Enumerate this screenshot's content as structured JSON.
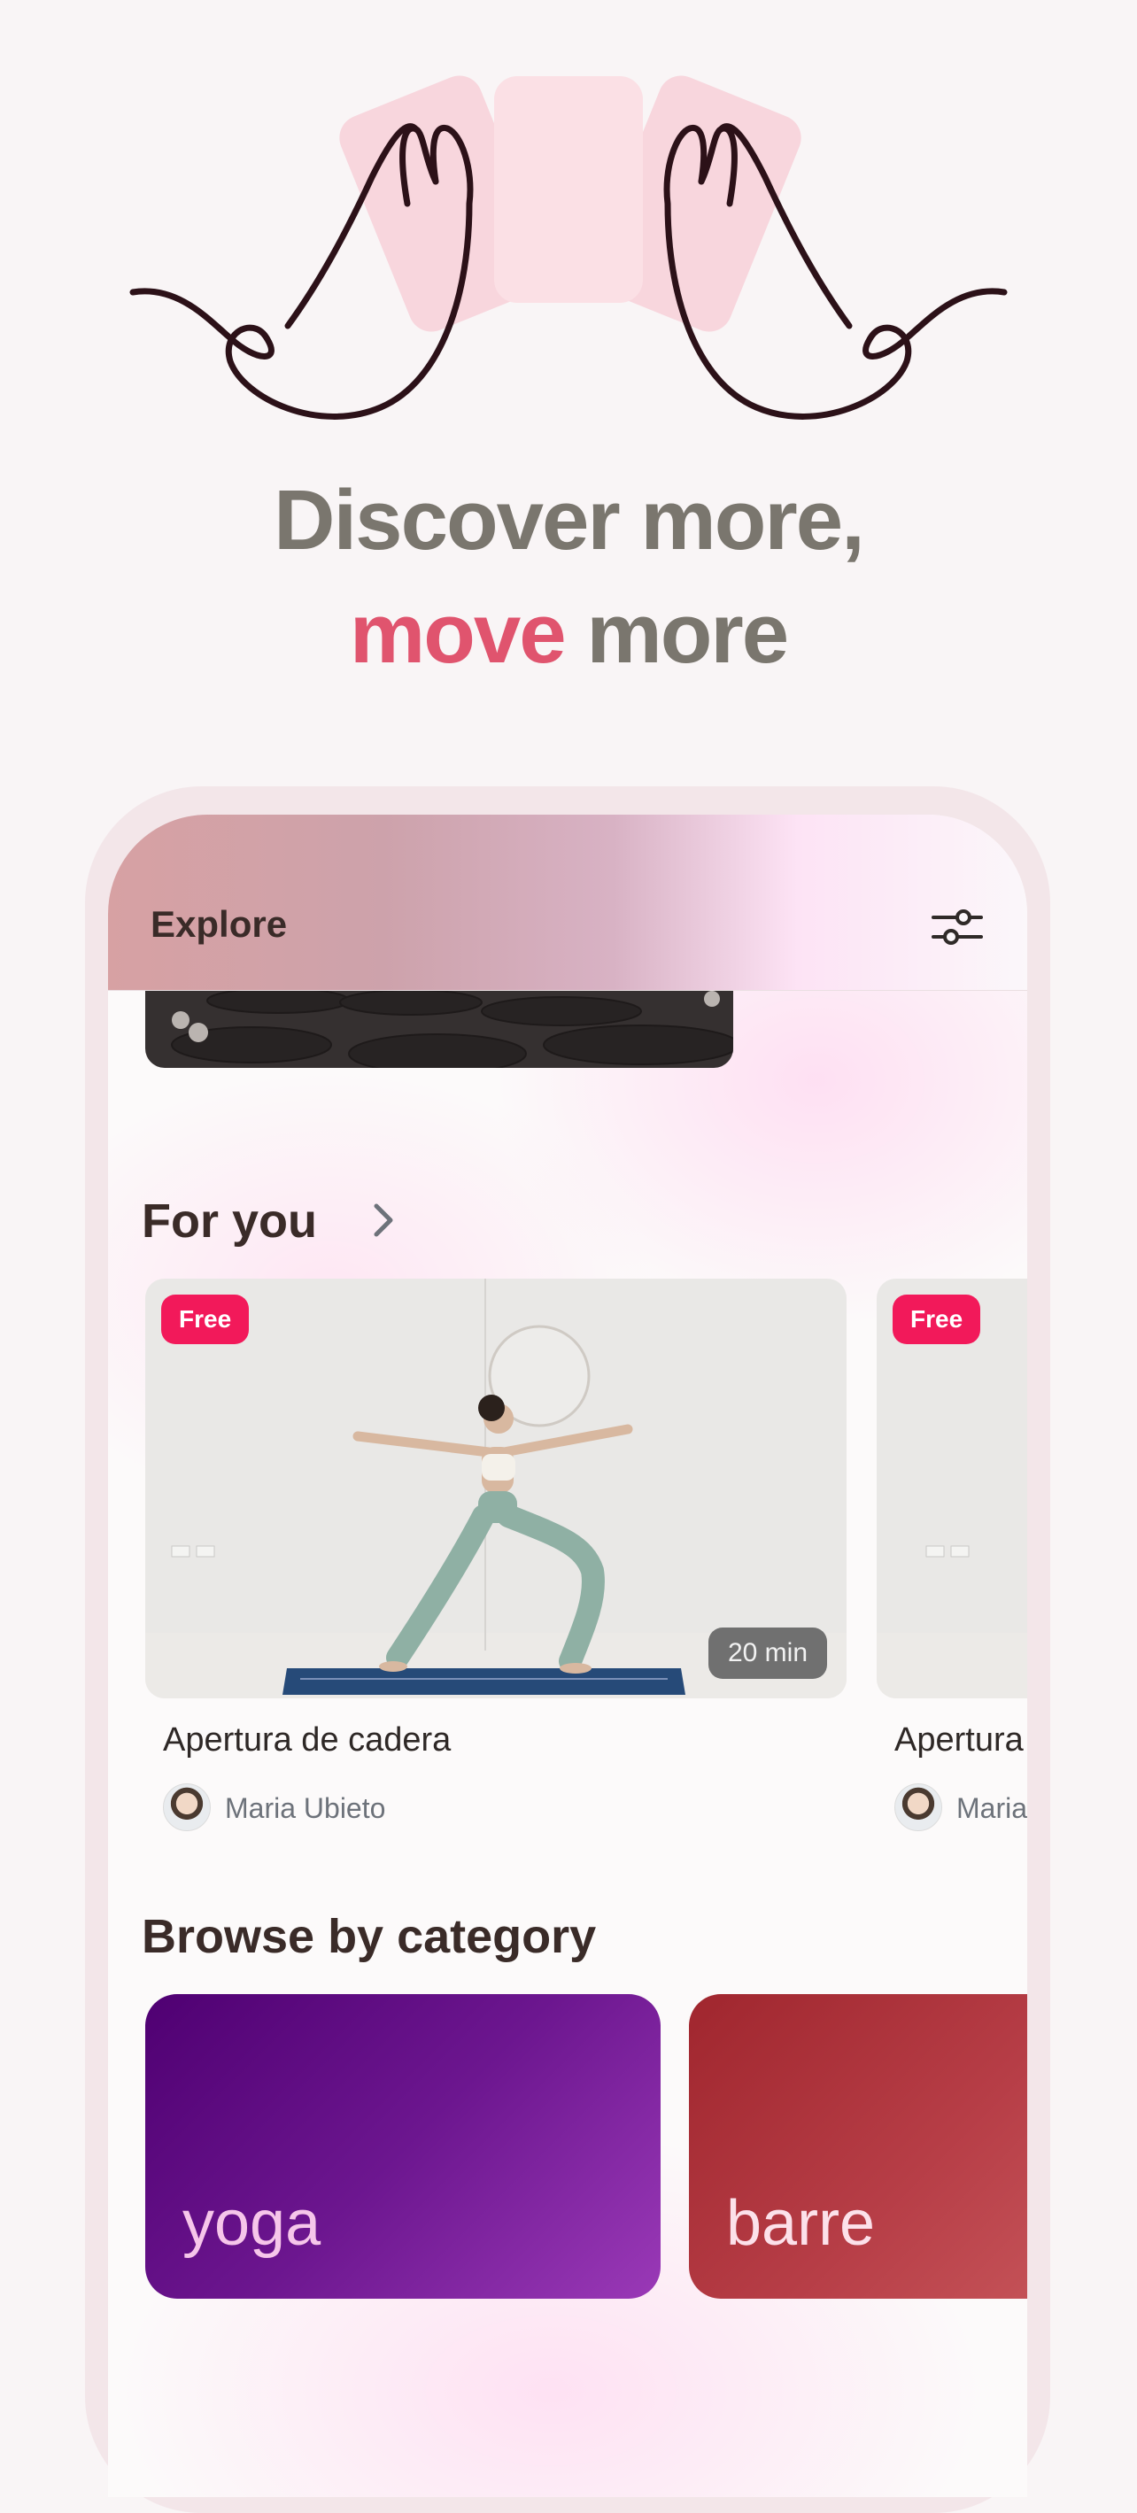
{
  "headline": {
    "line1": "Discover more,",
    "line2_accent": "move",
    "line2_rest": " more"
  },
  "app": {
    "header_title": "Explore",
    "sections": {
      "for_you": "For you",
      "browse_by_category": "Browse by category"
    },
    "classes": [
      {
        "title": "Apertura de cadera",
        "instructor": "Maria Ubieto",
        "badge": "Free",
        "duration": "20 min"
      },
      {
        "title": "Apertura",
        "instructor": "Maria",
        "badge": "Free"
      }
    ],
    "categories": [
      {
        "label": "yoga"
      },
      {
        "label": "barre"
      }
    ]
  },
  "colors": {
    "accent": "#e0546e",
    "free_badge": "#f2195a",
    "yoga_gradient": [
      "#4f0072",
      "#9a39b7"
    ],
    "barre_gradient": [
      "#a0262e",
      "#cd5f62"
    ]
  }
}
